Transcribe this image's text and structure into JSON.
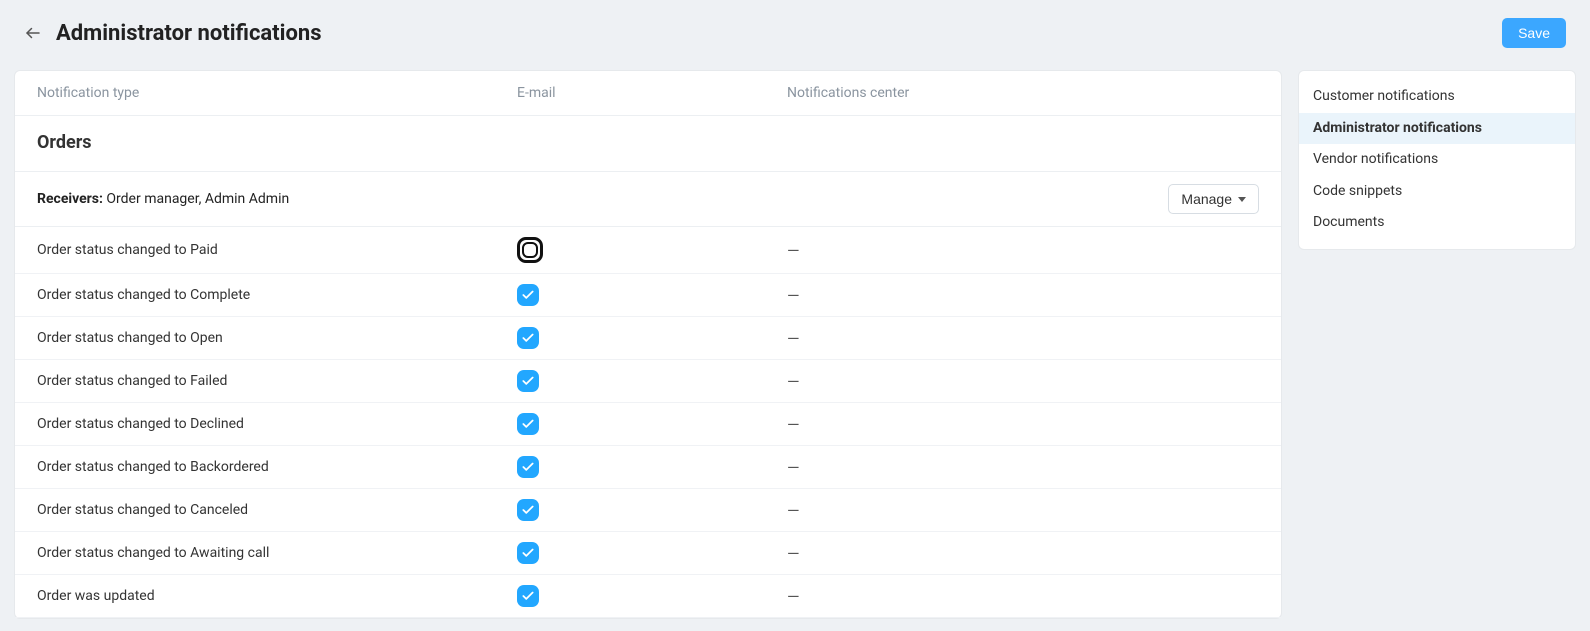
{
  "header": {
    "title": "Administrator notifications",
    "save_label": "Save"
  },
  "columns": {
    "type": "Notification type",
    "email": "E-mail",
    "nc": "Notifications center"
  },
  "section": {
    "title": "Orders",
    "receivers_label": "Receivers:",
    "receivers_value": "Order manager, Admin Admin",
    "manage_label": "Manage"
  },
  "rows": [
    {
      "label": "Order status changed to Paid",
      "email": "highlight",
      "nc": "—"
    },
    {
      "label": "Order status changed to Complete",
      "email": "checked",
      "nc": "—"
    },
    {
      "label": "Order status changed to Open",
      "email": "checked",
      "nc": "—"
    },
    {
      "label": "Order status changed to Failed",
      "email": "checked",
      "nc": "—"
    },
    {
      "label": "Order status changed to Declined",
      "email": "checked",
      "nc": "—"
    },
    {
      "label": "Order status changed to Backordered",
      "email": "checked",
      "nc": "—"
    },
    {
      "label": "Order status changed to Canceled",
      "email": "checked",
      "nc": "—"
    },
    {
      "label": "Order status changed to Awaiting call",
      "email": "checked",
      "nc": "—"
    },
    {
      "label": "Order was updated",
      "email": "checked",
      "nc": "—"
    }
  ],
  "sidebar": [
    {
      "label": "Customer notifications",
      "active": false
    },
    {
      "label": "Administrator notifications",
      "active": true
    },
    {
      "label": "Vendor notifications",
      "active": false
    },
    {
      "label": "Code snippets",
      "active": false
    },
    {
      "label": "Documents",
      "active": false
    }
  ]
}
